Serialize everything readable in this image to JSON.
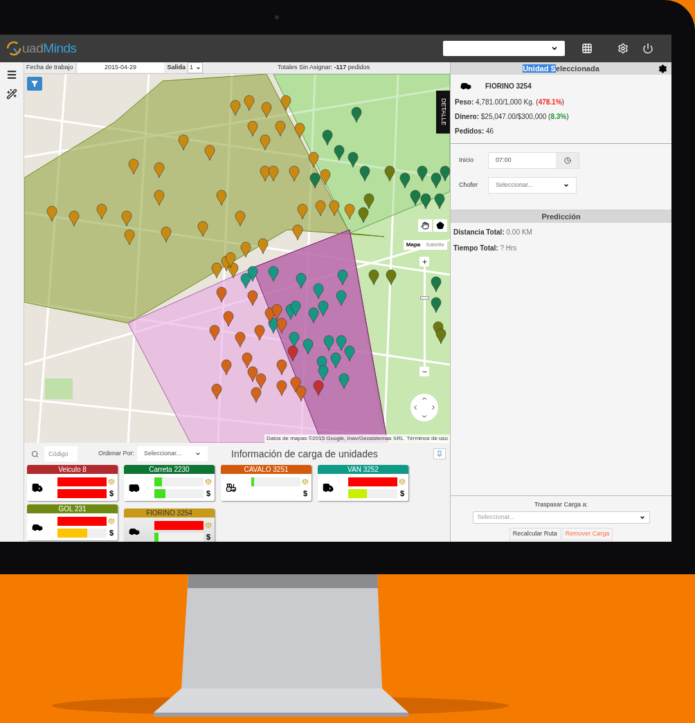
{
  "header": {
    "logo": {
      "prefix": "uad",
      "suffix": "Minds"
    }
  },
  "map_toolbar": {
    "date_label": "Fecha de trabajo",
    "date": "2015-04-29",
    "salida_label": "Salida",
    "salida": "1",
    "totals": "Totales Sin Asignar: **-117** pedidos"
  },
  "map": {
    "side_tab": "DETALLE",
    "map_types": [
      {
        "label": "Mapa",
        "selected": true
      },
      {
        "label": "Satelite",
        "selected": false
      }
    ],
    "zoom": {
      "level": 0.69
    },
    "attribution": "Datos de mapas ©2015 Google, Inav/Geosistemas SRL",
    "terms": "Términos de uso"
  },
  "units_panel": {
    "search_placeholder": "Código",
    "sort_label": "Ordenar Por:",
    "sort_value": "Seleccionar...",
    "title": "Información de carga de unidades",
    "units": [
      {
        "name": "Veiculo 8",
        "color": "#b02a2e",
        "kind": "truck",
        "selected": false,
        "money_symbol": "$",
        "weight": {
          "level": 1,
          "color": "#ff0000"
        },
        "money": {
          "level": 1,
          "color": "#ff0000"
        }
      },
      {
        "name": "Carreta 2230",
        "color": "#0e7433",
        "kind": "bus",
        "selected": false,
        "money_symbol": "$",
        "weight": {
          "level": 0.15,
          "color": "#44e020"
        },
        "money": {
          "level": 0.22,
          "color": "#44e020"
        }
      },
      {
        "name": "CAVALO 3251",
        "color": "#d35a0c",
        "kind": "tractor",
        "selected": false,
        "money_symbol": "$",
        "weight": {
          "level": 0.05,
          "color": "#44e020"
        }
      },
      {
        "name": "VAN 3252",
        "color": "#0f9a87",
        "kind": "van",
        "selected": false,
        "money_symbol": "$",
        "weight": {
          "level": 1,
          "color": "#ff0000"
        },
        "money": {
          "level": 0.38,
          "color": "#c8f000"
        }
      },
      {
        "name": "GOL 231",
        "color": "#6f8a12",
        "kind": "car",
        "selected": false,
        "money_symbol": "$",
        "weight": {
          "level": 1,
          "color": "#ff0000"
        },
        "money": {
          "level": 0.6,
          "color": "#ffc400"
        }
      },
      {
        "name": "FIORINO 3254",
        "color": "#c99a1a",
        "kind": "car",
        "selected": true,
        "money_symbol": "$",
        "weight": {
          "level": 1,
          "color": "#ff0000"
        },
        "money": {
          "level": 0.08,
          "color": "#44e020"
        }
      }
    ]
  },
  "selected_unit": {
    "title": [
      {
        "text": "Unidad S",
        "highlighted": true
      },
      {
        "text": "eleccionada",
        "highlighted": false
      }
    ],
    "name": "FIORINO 3254",
    "stats": [
      {
        "label": "Peso:",
        "value": " 4,781.00/1,000 Kg. (",
        "percent": "478.1%",
        "suffix": ")",
        "color": "#ff1f1f"
      },
      {
        "label": "Dinero:",
        "value": " $25,047.00/$300,000 (",
        "percent": "8.3%",
        "suffix": ")",
        "color": "#1e9a2a"
      },
      {
        "label": "Pedidos:",
        "value": " 46"
      }
    ],
    "start_label": "Inicio",
    "start": "07:00",
    "driver_label": "Chofer",
    "driver": "Seleccionar..."
  },
  "prediction": {
    "title": "Predicción",
    "rows": [
      {
        "label": "Distancia Total:",
        "value": " 0.00 KM"
      },
      {
        "label": "Tiempo Total:",
        "value": " ? Hrs"
      }
    ]
  },
  "transfer": {
    "label": "Traspasar Carga a:",
    "select": "Seleccionar...",
    "buttons": [
      {
        "label": "Recalcular Ruta",
        "kind": "default"
      },
      {
        "label": "Remover Carga",
        "kind": "danger"
      }
    ]
  }
}
